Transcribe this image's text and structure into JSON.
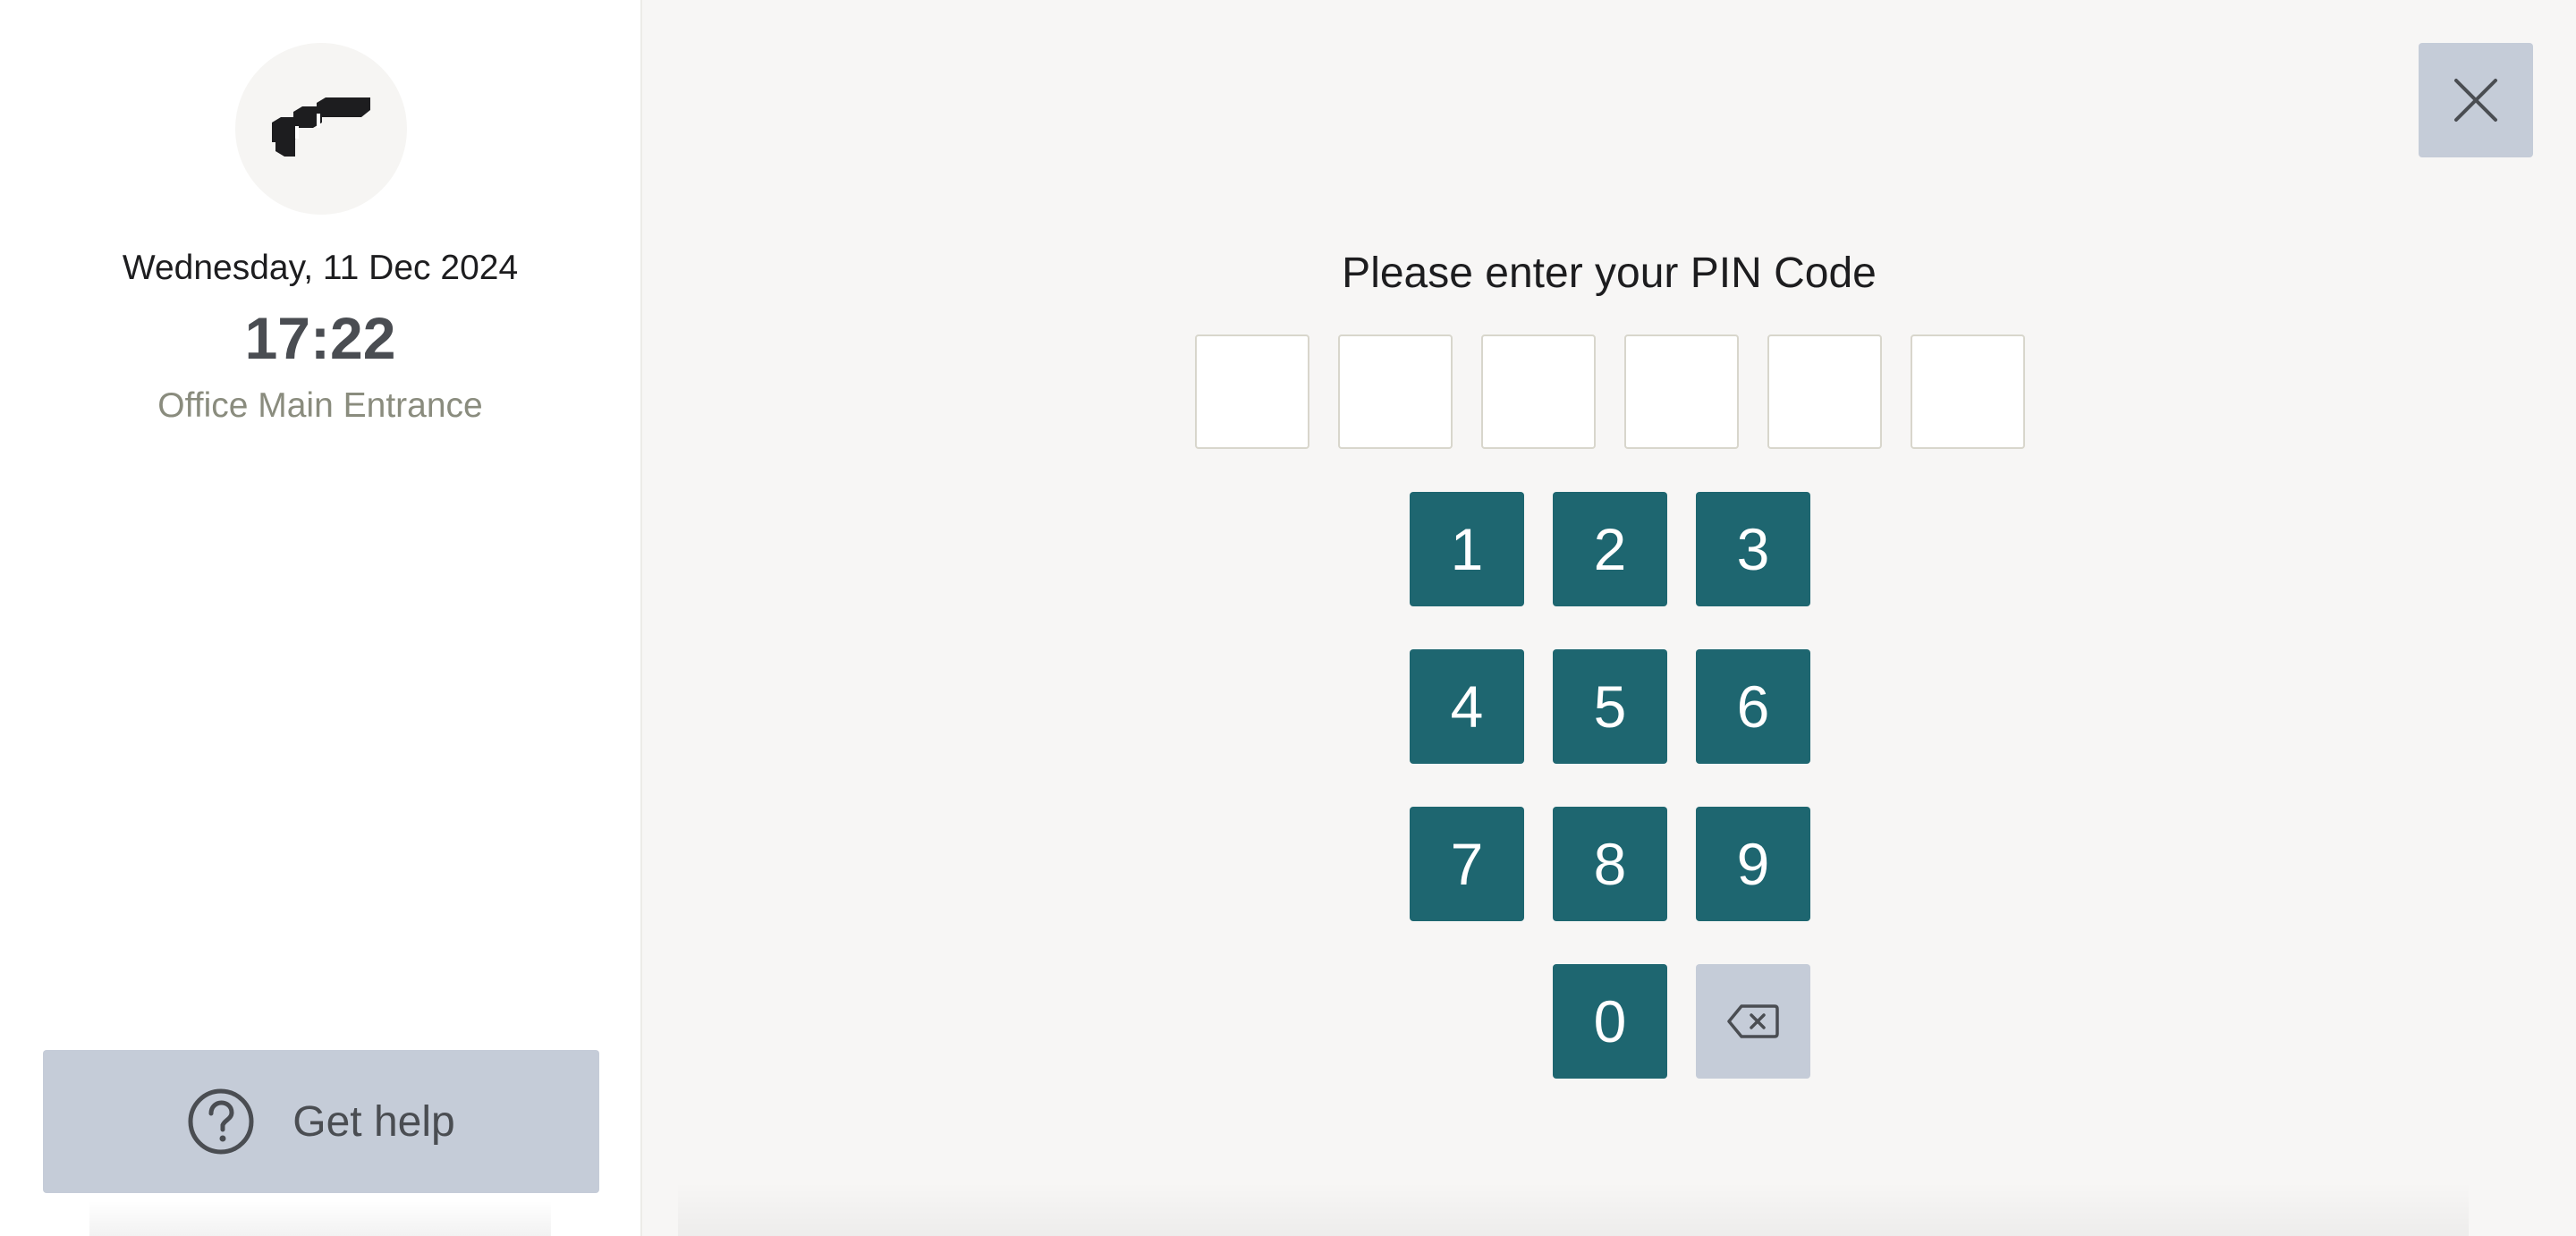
{
  "sidebar": {
    "date": "Wednesday, 11 Dec 2024",
    "time": "17:22",
    "location": "Office Main Entrance",
    "logo_icon": "stacked-blocks-logo",
    "help": {
      "label": "Get help",
      "icon": "question-circle-icon"
    }
  },
  "main": {
    "title": "Please enter your PIN Code",
    "close_icon": "close-icon",
    "pin_length": 6,
    "keypad": {
      "keys": [
        "1",
        "2",
        "3",
        "4",
        "5",
        "6",
        "7",
        "8",
        "9",
        "0"
      ],
      "backspace_icon": "backspace-icon"
    }
  },
  "colors": {
    "key_bg": "#1e6670",
    "neutral_button_bg": "#c5ccd8",
    "page_bg": "#f7f6f5"
  }
}
